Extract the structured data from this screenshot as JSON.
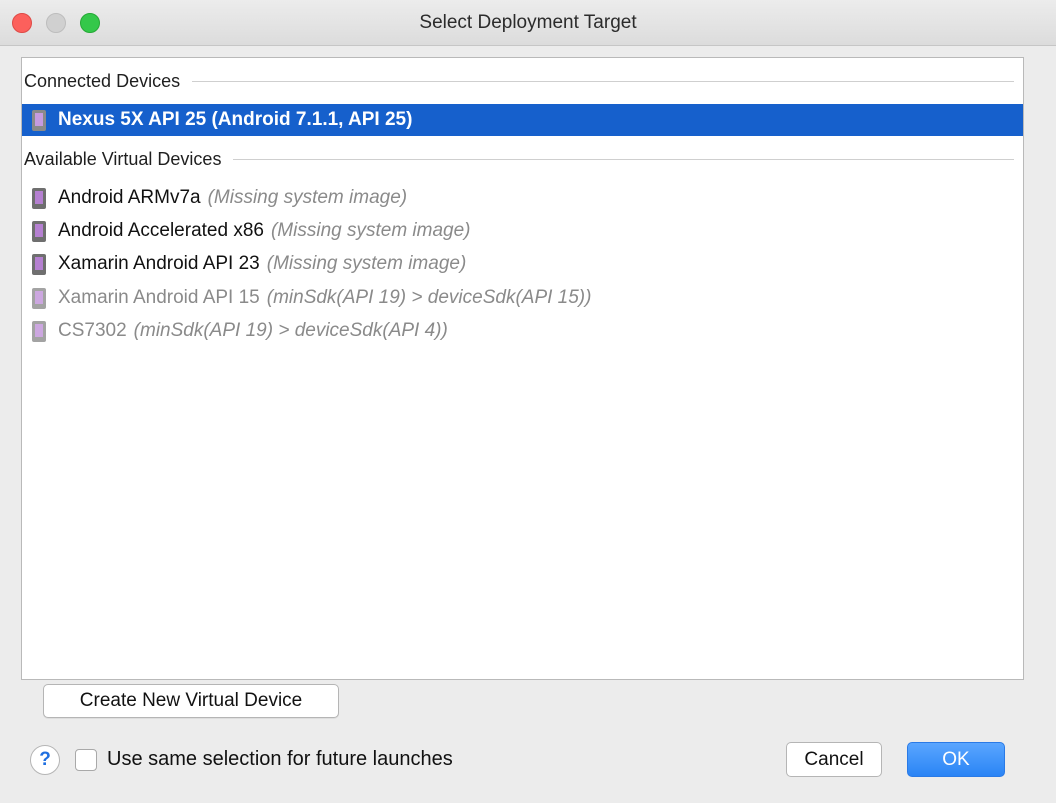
{
  "window": {
    "title": "Select Deployment Target"
  },
  "connected": {
    "header": "Connected Devices",
    "devices": [
      {
        "name": "Nexus 5X API 25 (Android 7.1.1, API 25)",
        "note": "",
        "icon": "phone-icon",
        "selected": true
      }
    ]
  },
  "virtual": {
    "header": "Available Virtual Devices",
    "devices": [
      {
        "name": "Android ARMv7a",
        "note": "(Missing system image)",
        "icon": "phone-icon",
        "disabled": false
      },
      {
        "name": "Android Accelerated x86",
        "note": "(Missing system image)",
        "icon": "phone-icon",
        "disabled": false
      },
      {
        "name": "Xamarin Android API 23",
        "note": "(Missing system image)",
        "icon": "phone-icon",
        "disabled": false
      },
      {
        "name": "Xamarin Android API 15",
        "note": "(minSdk(API 19) > deviceSdk(API 15))",
        "icon": "phone-icon",
        "disabled": true
      },
      {
        "name": "CS7302",
        "note": "(minSdk(API 19) > deviceSdk(API 4))",
        "icon": "phone-icon",
        "disabled": true
      }
    ]
  },
  "buttons": {
    "create": "Create New Virtual Device",
    "help": "?",
    "cancel": "Cancel",
    "ok": "OK"
  },
  "options": {
    "same_selection_label": "Use same selection for future launches",
    "same_selection_checked": false
  },
  "colors": {
    "selection": "#1660cc",
    "ok": "#2a84f5",
    "accent_icon": "#b580d1"
  }
}
